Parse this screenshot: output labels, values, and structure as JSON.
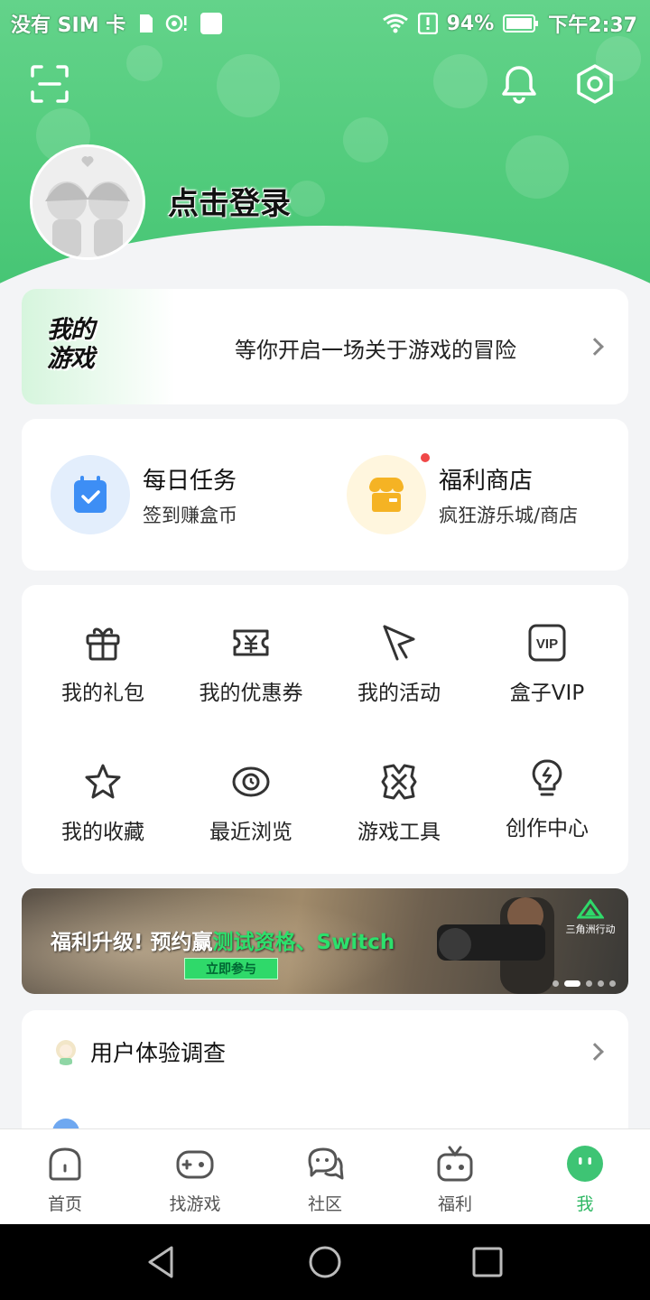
{
  "status_bar": {
    "carrier": "没有 SIM 卡",
    "battery": "94%",
    "time": "下午2:37"
  },
  "header": {
    "login_text": "点击登录"
  },
  "promo": {
    "logo_text_line1": "我的",
    "logo_text_line2": "游戏",
    "text": "等你开启一场关于游戏的冒险"
  },
  "tasks": [
    {
      "title": "每日任务",
      "subtitle": "签到赚盒币",
      "icon": "calendar-check-icon"
    },
    {
      "title": "福利商店",
      "subtitle": "疯狂游乐城/商店",
      "icon": "shop-icon",
      "has_badge": true
    }
  ],
  "grid": [
    {
      "label": "我的礼包",
      "icon": "gift-icon"
    },
    {
      "label": "我的优惠券",
      "icon": "coupon-icon"
    },
    {
      "label": "我的活动",
      "icon": "flag-icon"
    },
    {
      "label": "盒子VIP",
      "icon": "vip-icon"
    },
    {
      "label": "我的收藏",
      "icon": "star-icon"
    },
    {
      "label": "最近浏览",
      "icon": "eye-icon"
    },
    {
      "label": "游戏工具",
      "icon": "tools-icon"
    },
    {
      "label": "创作中心",
      "icon": "lightbulb-icon"
    }
  ],
  "banner": {
    "title_prefix": "福利升级! 预约赢",
    "title_highlight": "测试资格、Switch",
    "button": "立即参与",
    "brand": "三角洲行动",
    "slides_total": 5,
    "active_slide": 2
  },
  "list": [
    {
      "label": "用户体验调查",
      "icon": "survey-avatar-icon"
    },
    {
      "label": "",
      "icon": "partial-item-icon"
    }
  ],
  "tabbar": [
    {
      "label": "首页",
      "icon": "home-icon",
      "active": false
    },
    {
      "label": "找游戏",
      "icon": "gamepad-icon",
      "active": false
    },
    {
      "label": "社区",
      "icon": "chat-icon",
      "active": false
    },
    {
      "label": "福利",
      "icon": "gift-box-icon",
      "active": false
    },
    {
      "label": "我",
      "icon": "me-face-icon",
      "active": true
    }
  ],
  "colors": {
    "accent_green": "#4fca7a",
    "active_tab": "#2fb864",
    "badge_red": "#f04848"
  }
}
